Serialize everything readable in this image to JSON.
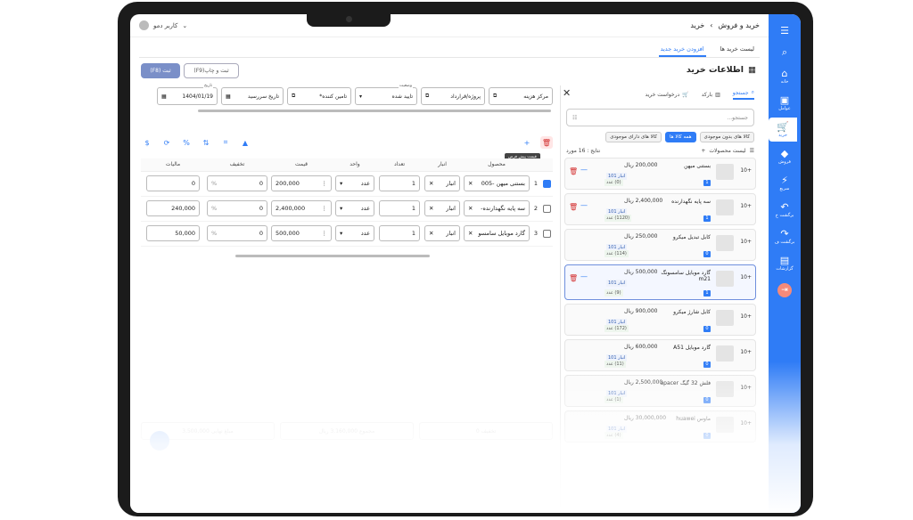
{
  "topbar": {
    "crumb_section": "خرید و فروش",
    "crumb_page": "خرید",
    "user_name": "کاربر دمو"
  },
  "nav": {
    "items": [
      {
        "label": "",
        "icon": "collapse-icon"
      },
      {
        "label": "",
        "icon": "search-icon"
      },
      {
        "label": "خانه",
        "icon": "home-icon"
      },
      {
        "label": "عوامل",
        "icon": "contacts-icon"
      },
      {
        "label": "خرید",
        "icon": "cart-icon"
      },
      {
        "label": "فروش",
        "icon": "tag-icon"
      },
      {
        "label": "سریع",
        "icon": "bolt-icon"
      },
      {
        "label": "برگشت خ",
        "icon": "return-icon"
      },
      {
        "label": "برگشت ف",
        "icon": "return-sale-icon"
      },
      {
        "label": "گزارشات",
        "icon": "report-icon"
      }
    ]
  },
  "tabs": {
    "list": "لیست خرید ها",
    "add": "افزودن خرید جدید"
  },
  "title": "اطلاعات خرید",
  "buttons": {
    "save": "ثبت (F8)",
    "save_print": "ثبت و چاپ(F9)"
  },
  "fields": {
    "date_label": "تاریخ",
    "date": "1404/01/19",
    "due_date": "تاریخ سررسید",
    "supplier": "تامین کننده*",
    "status_label": "وضعیت",
    "status": "تایید شده",
    "project": "پروژه/قرارداد",
    "cost_center": "مرکز هزینه"
  },
  "tooltip": "قیمت پیش فرض",
  "grid": {
    "headers": {
      "product": "محصول",
      "warehouse": "انبار",
      "count": "تعداد",
      "unit": "واحد",
      "price": "قیمت",
      "discount": "تخفیف",
      "tax": "مالیات"
    },
    "rows": [
      {
        "num": "1",
        "product": "بستنی میهن -005",
        "warehouse": "انبار",
        "count": "1",
        "unit": "عدد",
        "price": "200,000",
        "discount": "0",
        "pct": "%",
        "tax": "0",
        "checked": true
      },
      {
        "num": "2",
        "product": "سه پایه نگهدارنده-",
        "warehouse": "انبار",
        "count": "1",
        "unit": "عدد",
        "price": "2,400,000",
        "discount": "0",
        "pct": "%",
        "tax": "240,000",
        "checked": false
      },
      {
        "num": "3",
        "product": "گارد موبایل سامسو",
        "warehouse": "انبار",
        "count": "1",
        "unit": "عدد",
        "price": "500,000",
        "discount": "0",
        "pct": "%",
        "tax": "50,000",
        "checked": false
      }
    ]
  },
  "panel": {
    "tab_search": "جستجو",
    "tab_barcode": "بارکد",
    "tab_request": "درخواست خرید",
    "search_placeholder": "جستجو...",
    "chip_no_stock": "کالا های بدون موجودی",
    "chip_all": "همه کالا ها",
    "chip_in_stock": "کالا های دارای موجودی",
    "list_title": "لیست محصولات",
    "result_count": "نتایج : 16 مورد",
    "items": [
      {
        "qty": "+10",
        "name": "بستنی میهن",
        "price": "200,000 ریال",
        "stock": "انبار 101",
        "stock2": "(0) عدد",
        "badge": "1",
        "in_cart": true
      },
      {
        "qty": "+10",
        "name": "سه پایه نگهدارنده",
        "price": "2,400,000 ریال",
        "stock": "انبار 101",
        "stock2": "(1120) عدد",
        "badge": "1",
        "in_cart": true
      },
      {
        "qty": "+10",
        "name": "کابل تبدیل میکرو",
        "price": "250,000 ریال",
        "stock": "انبار 101",
        "stock2": "(114) عدد",
        "badge": "0",
        "in_cart": false
      },
      {
        "qty": "+10",
        "name": "گارد موبایل سامسونگ m21",
        "price": "500,000 ریال",
        "stock": "انبار 101",
        "stock2": "(9) عدد",
        "badge": "1",
        "in_cart": true
      },
      {
        "qty": "+10",
        "name": "کابل شارژ میکرو",
        "price": "900,000 ریال",
        "stock": "انبار 101",
        "stock2": "(172) عدد",
        "badge": "0",
        "in_cart": false
      },
      {
        "qty": "+10",
        "name": "گارد موبایل A51",
        "price": "600,000 ریال",
        "stock": "انبار 101",
        "stock2": "(11) عدد",
        "badge": "0",
        "in_cart": false
      },
      {
        "qty": "+10",
        "name": "فلش 32 گیگ apacer",
        "price": "2,500,000 ریال",
        "stock": "انبار 101",
        "stock2": "(1) عدد",
        "badge": "0",
        "in_cart": false
      },
      {
        "qty": "+10",
        "name": "ماوس huawei",
        "price": "30,000,000 ریال",
        "stock": "انبار 101",
        "stock2": "(4) عدد",
        "badge": "0",
        "in_cart": false
      }
    ]
  },
  "summary": {
    "total_label": "مبلغ نهایی",
    "total": "3,500,000",
    "sum_label": "مجموع",
    "sum": "3,160,000",
    "discount_label": "تخفیف",
    "discount": "0",
    "rial": "ریال"
  }
}
